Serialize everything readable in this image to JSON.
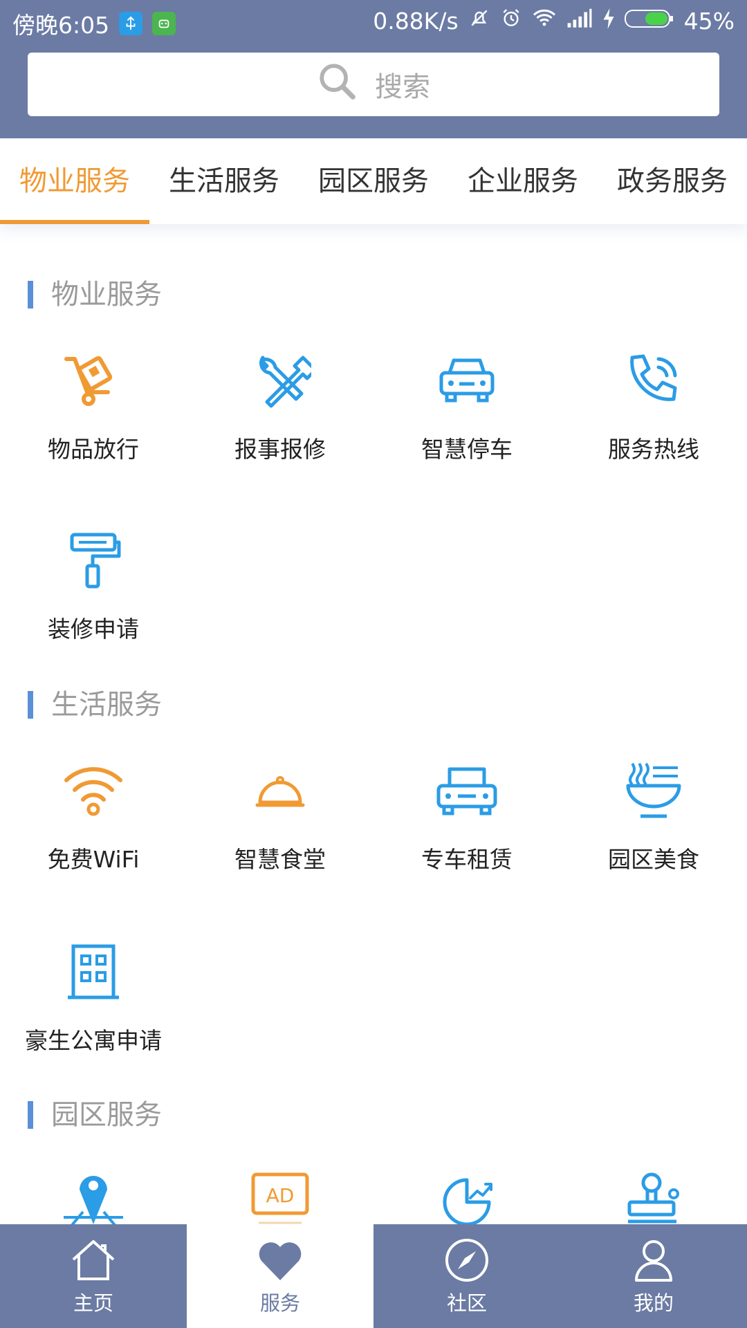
{
  "status": {
    "time": "傍晚6:05",
    "speed": "0.88K/s",
    "battery": "45%"
  },
  "search": {
    "placeholder": "搜索"
  },
  "tabs": [
    "物业服务",
    "生活服务",
    "园区服务",
    "企业服务",
    "政务服务"
  ],
  "sections": {
    "property": {
      "title": "物业服务",
      "items": [
        {
          "label": "物品放行",
          "icon": "cart-icon"
        },
        {
          "label": "报事报修",
          "icon": "repair-tools-icon"
        },
        {
          "label": "智慧停车",
          "icon": "car-icon"
        },
        {
          "label": "服务热线",
          "icon": "phone-icon"
        },
        {
          "label": "装修申请",
          "icon": "paint-roller-icon"
        }
      ]
    },
    "life": {
      "title": "生活服务",
      "items": [
        {
          "label": "免费WiFi",
          "icon": "wifi-icon"
        },
        {
          "label": "智慧食堂",
          "icon": "cloche-icon"
        },
        {
          "label": "专车租赁",
          "icon": "car-icon"
        },
        {
          "label": "园区美食",
          "icon": "bowl-icon"
        },
        {
          "label": "豪生公寓申请",
          "icon": "building-icon"
        }
      ]
    },
    "park": {
      "title": "园区服务",
      "icons": [
        "map-pin-icon",
        "ad-icon",
        "pie-chart-icon",
        "stamp-icon"
      ]
    }
  },
  "bottom_nav": [
    {
      "label": "主页",
      "icon": "home-icon"
    },
    {
      "label": "服务",
      "icon": "heart-icon"
    },
    {
      "label": "社区",
      "icon": "compass-icon"
    },
    {
      "label": "我的",
      "icon": "user-icon"
    }
  ],
  "colors": {
    "header": "#6b7ba4",
    "accent": "#f09a34",
    "blue_icon": "#2b9ce6",
    "section_bar": "#5b8fd6"
  }
}
